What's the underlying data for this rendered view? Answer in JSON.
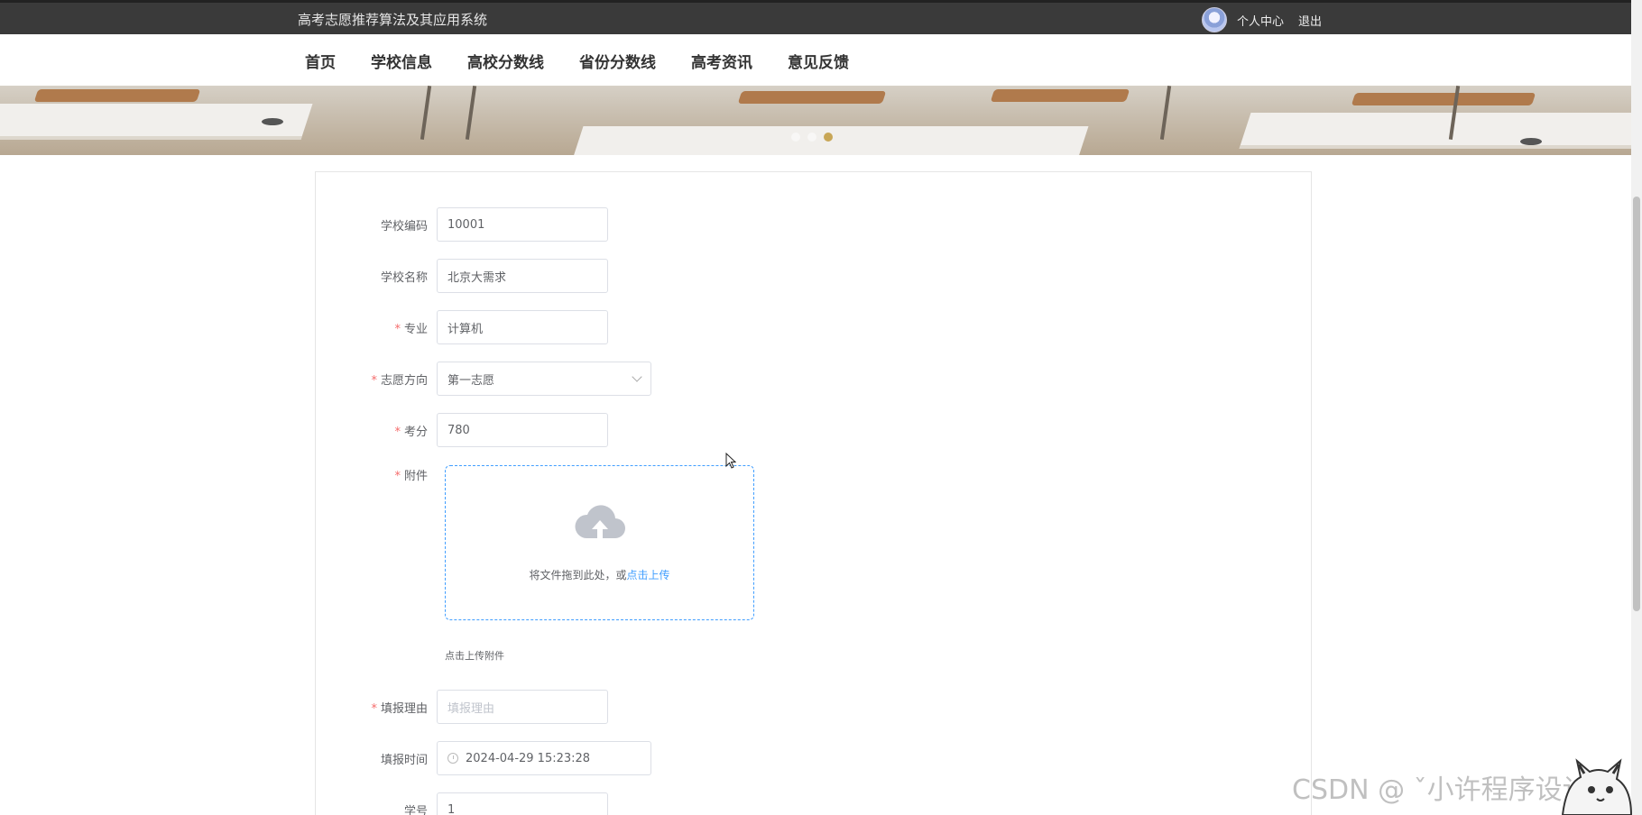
{
  "header": {
    "site_title": "高考志愿推荐算法及其应用系统",
    "user_center": "个人中心",
    "logout": "退出"
  },
  "nav": {
    "items": [
      "首页",
      "学校信息",
      "高校分数线",
      "省份分数线",
      "高考资讯",
      "意见反馈"
    ]
  },
  "banner": {
    "slide_count": 3,
    "active_slide": 3
  },
  "form": {
    "school_code": {
      "label": "学校编码",
      "value": "10001",
      "required": false
    },
    "school_name": {
      "label": "学校名称",
      "value": "北京大需求",
      "required": false
    },
    "major": {
      "label": "专业",
      "value": "计算机",
      "required": true
    },
    "preference": {
      "label": "志愿方向",
      "value": "第一志愿",
      "required": true
    },
    "score": {
      "label": "考分",
      "value": "780",
      "required": true
    },
    "attachment": {
      "label": "附件",
      "required": true,
      "drop_text": "将文件拖到此处，或",
      "upload_link": "点击上传",
      "tip": "点击上传附件",
      "icon": "upload-cloud-icon"
    },
    "reason": {
      "label": "填报理由",
      "placeholder": "填报理由",
      "required": true
    },
    "fill_time": {
      "label": "填报时间",
      "value": "2024-04-29 15:23:28",
      "icon": "clock-icon",
      "required": false
    },
    "student_no": {
      "label": "学号",
      "value": "1",
      "required": false
    }
  },
  "watermark": "CSDN @ ˇ小许程序设计",
  "colors": {
    "topbar": "#3a3a3a",
    "accent": "#409eff",
    "required": "#f56c6c",
    "dot_active": "#c8a656"
  }
}
